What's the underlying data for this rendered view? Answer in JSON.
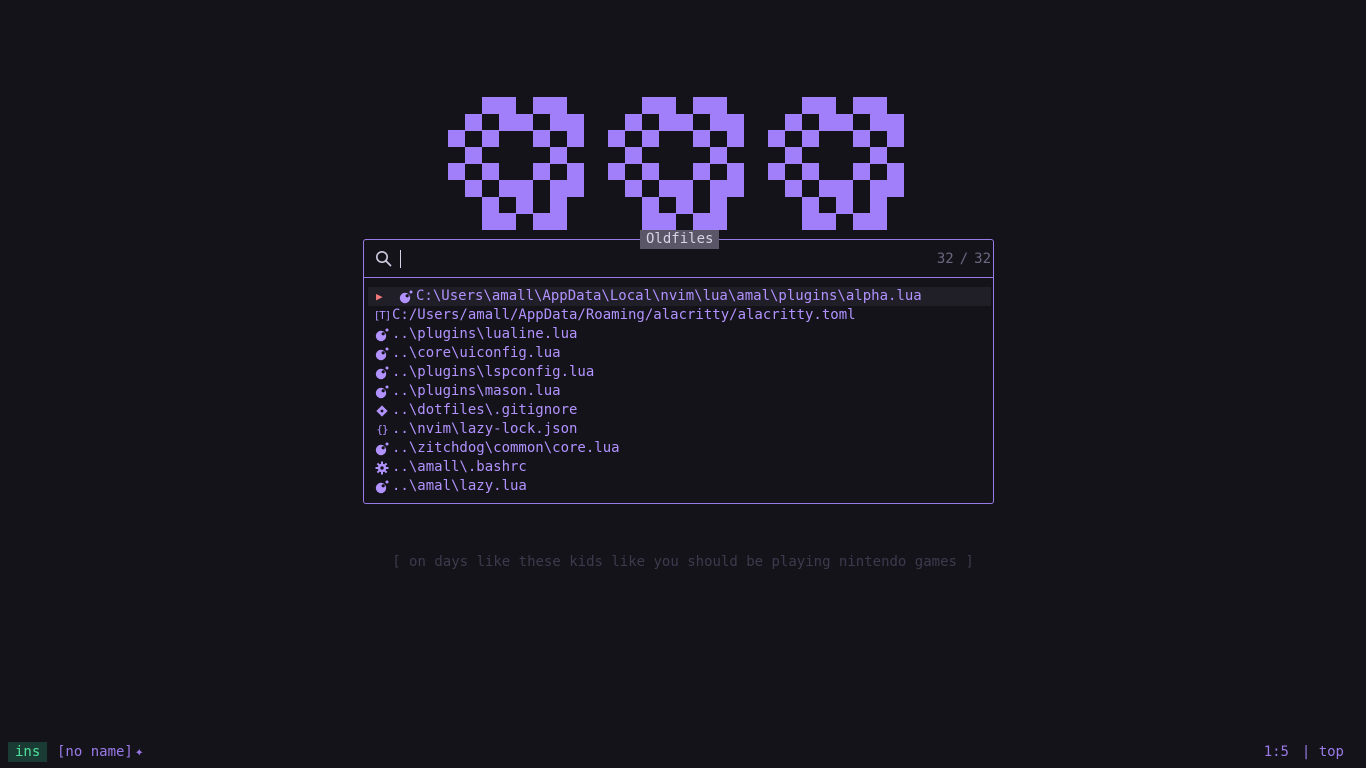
{
  "picker": {
    "title": "Oldfiles",
    "query": "",
    "count_matched": "32",
    "count_sep": "/",
    "count_total": "32",
    "selected_index": 0,
    "selection_caret": "▶",
    "items": [
      {
        "icon": "lua-icon",
        "path": "C:\\Users\\amall\\AppData\\Local\\nvim\\lua\\amal\\plugins\\alpha.lua"
      },
      {
        "icon": "toml-icon",
        "icon_text": "[T]",
        "path": "C:/Users/amall/AppData/Roaming/alacritty/alacritty.toml"
      },
      {
        "icon": "lua-icon",
        "path": "..\\plugins\\lualine.lua"
      },
      {
        "icon": "lua-icon",
        "path": "..\\core\\uiconfig.lua"
      },
      {
        "icon": "lua-icon",
        "path": "..\\plugins\\lspconfig.lua"
      },
      {
        "icon": "lua-icon",
        "path": "..\\plugins\\mason.lua"
      },
      {
        "icon": "git-icon",
        "path": "..\\dotfiles\\.gitignore"
      },
      {
        "icon": "json-icon",
        "icon_text": "{}",
        "path": "..\\nvim\\lazy-lock.json"
      },
      {
        "icon": "lua-icon",
        "path": "..\\zitchdog\\common\\core.lua"
      },
      {
        "icon": "gear-icon",
        "path": "..\\amall\\.bashrc"
      },
      {
        "icon": "lua-icon",
        "path": "..\\amal\\lazy.lua"
      }
    ]
  },
  "quote": "[ on days like these kids like you should be playing nintendo games ]",
  "statusline": {
    "mode": "ins",
    "filename": "[no name]",
    "modified_marker": "✦",
    "position": "1:5",
    "scroll": "| top"
  },
  "colors": {
    "background": "#141319",
    "accent": "#a17ffa",
    "caret": "#f2787c",
    "mode_fg": "#4ee09a",
    "mode_bg": "#1a3b34",
    "muted": "#6b6882",
    "quote": "#3c3a4c"
  }
}
